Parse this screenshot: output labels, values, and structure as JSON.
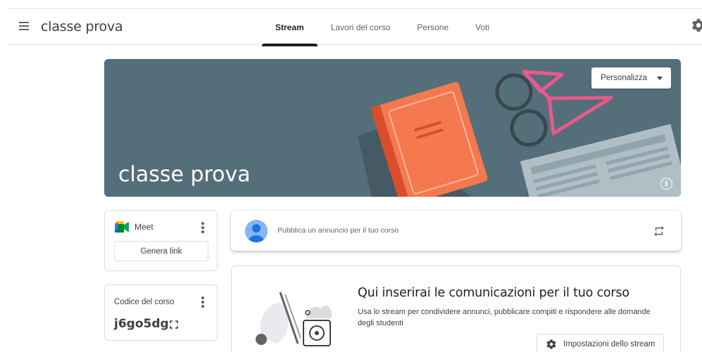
{
  "header": {
    "menu_icon": "hamburger-menu-icon",
    "title": "classe prova",
    "tabs": [
      {
        "label": "Stream",
        "active": true
      },
      {
        "label": "Lavori del corso",
        "active": false
      },
      {
        "label": "Persone",
        "active": false
      },
      {
        "label": "Voti",
        "active": false
      }
    ],
    "settings_icon": "gear-icon"
  },
  "banner": {
    "title": "classe prova",
    "customize_label": "Personalizza",
    "info_icon": "info-icon",
    "colors": {
      "background": "#546e7a",
      "book": "#f4794e",
      "glasses": "#e85a8a"
    }
  },
  "meet": {
    "label": "Meet",
    "generate_link_label": "Genera link",
    "more_icon": "more-vert-icon"
  },
  "class_code": {
    "label": "Codice del corso",
    "value": "j6go5dg",
    "fullscreen_icon": "fullscreen-icon",
    "more_icon": "more-vert-icon"
  },
  "announcement": {
    "placeholder": "Pubblica un annuncio per il tuo corso",
    "repost_icon": "repost-icon"
  },
  "stream_info": {
    "title": "Qui inserirai le comunicazioni per il tuo corso",
    "description": "Usa lo stream per condividere annunci, pubblicare compiti e rispondere alle domande degli studenti",
    "settings_label": "Impostazioni dello stream",
    "settings_icon": "gear-icon"
  }
}
